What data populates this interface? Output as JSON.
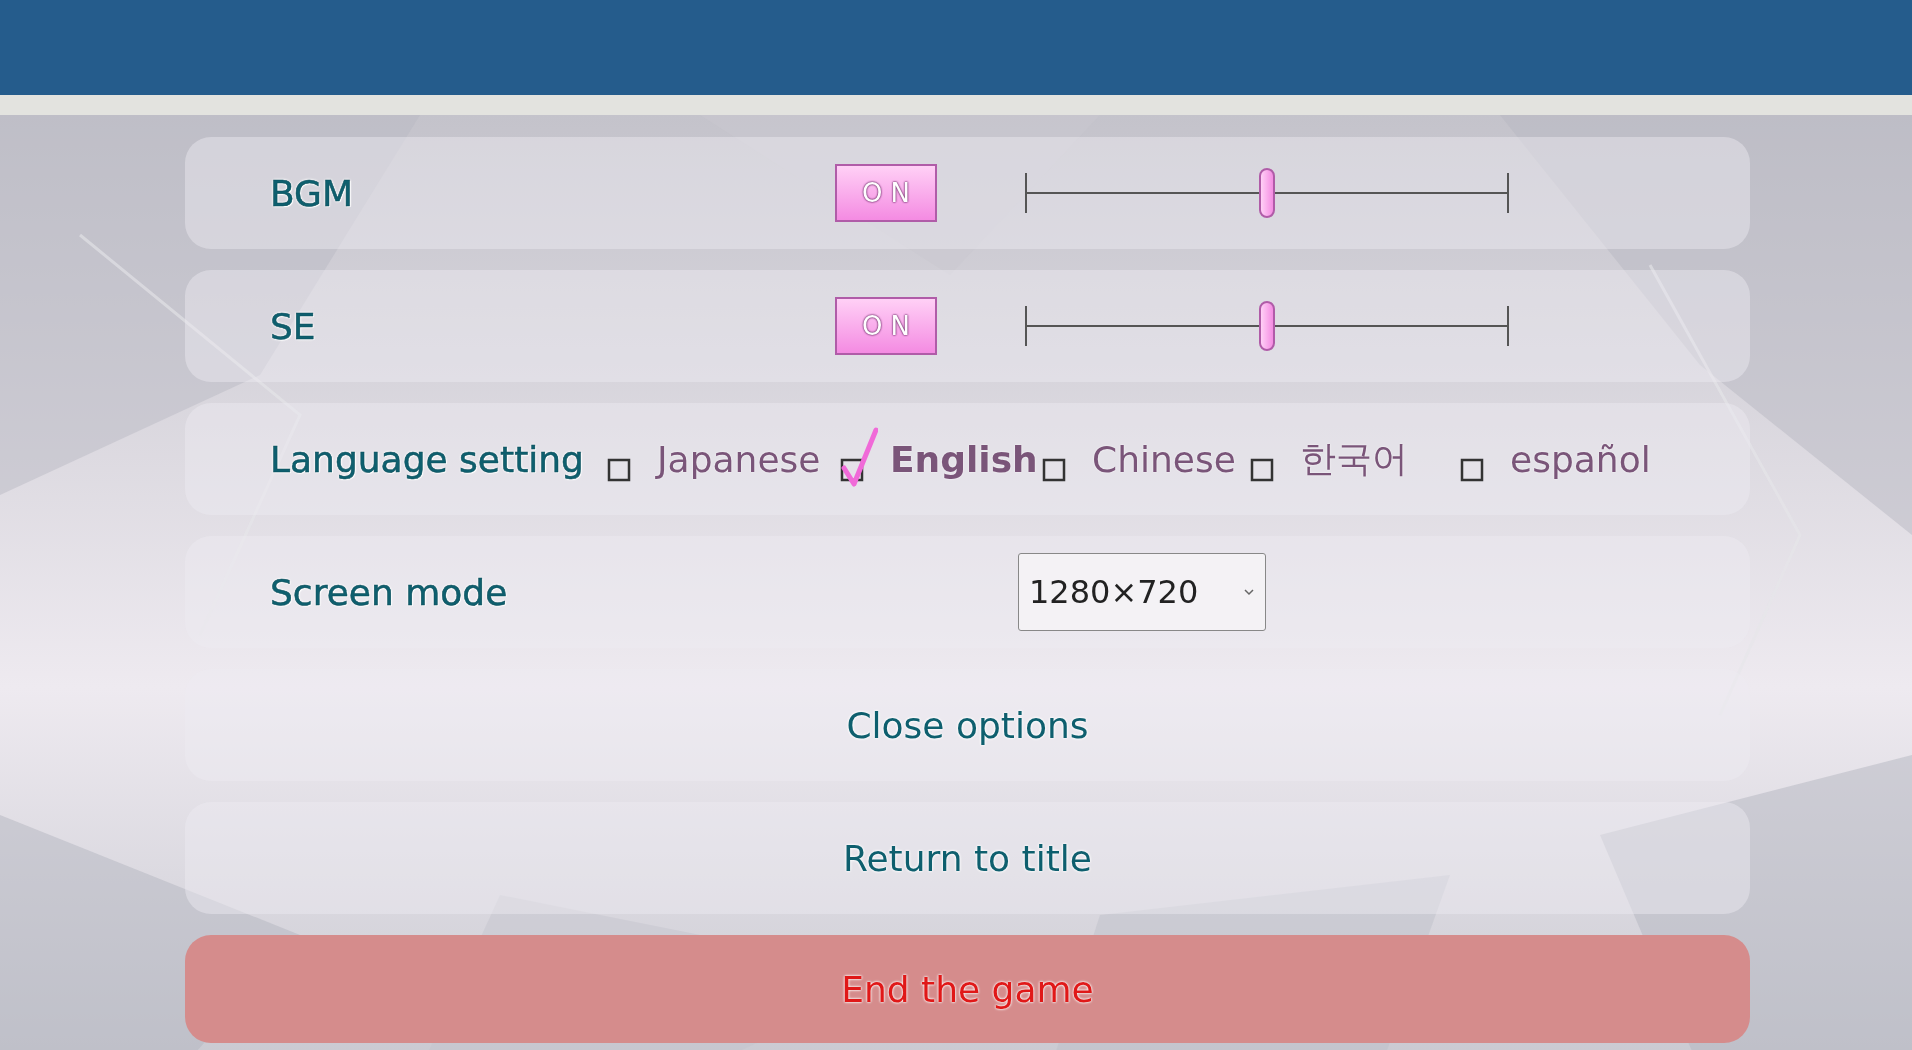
{
  "settings": [
    {
      "kind": "audio",
      "label": "BGM",
      "toggle": "ON",
      "on": true,
      "level": 0.5
    },
    {
      "kind": "audio",
      "label": "SE",
      "toggle": "ON",
      "on": true,
      "level": 0.5
    }
  ],
  "language": {
    "label": "Language setting",
    "options": [
      {
        "label": "Japanese",
        "selected": false
      },
      {
        "label": "English",
        "selected": true
      },
      {
        "label": "Chinese",
        "selected": false
      },
      {
        "label": "한국어",
        "selected": false
      },
      {
        "label": "español",
        "selected": false
      }
    ]
  },
  "screen_mode": {
    "label": "Screen mode",
    "value": "1280×720"
  },
  "actions": [
    {
      "label": "Close options",
      "kind": "normal"
    },
    {
      "label": "Return to title",
      "kind": "normal"
    },
    {
      "label": "End the game",
      "kind": "danger"
    }
  ]
}
